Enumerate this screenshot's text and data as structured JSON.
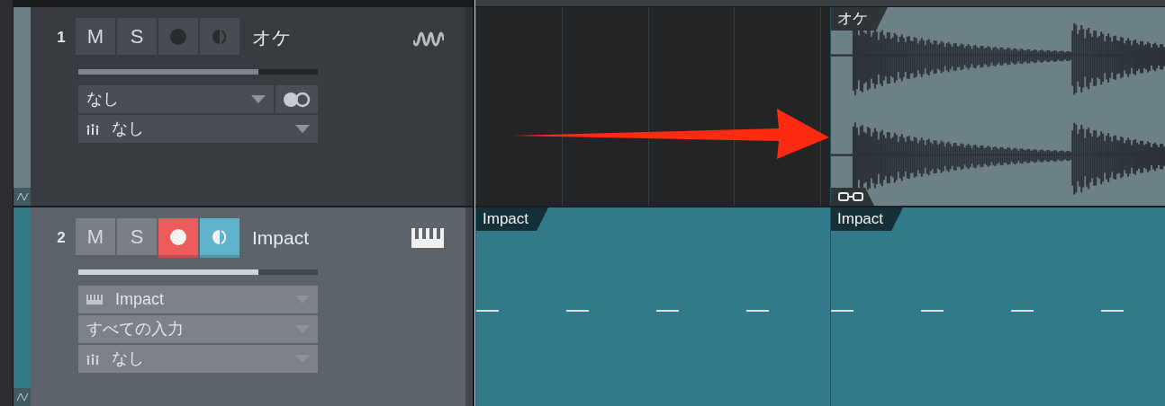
{
  "tracks": [
    {
      "number": "1",
      "mute_label": "M",
      "solo_label": "S",
      "name": "オケ",
      "kind": "audio",
      "color": "#6d8086",
      "selected": false,
      "muted": false,
      "solo": false,
      "record_armed": false,
      "monitor": false,
      "volume": {
        "level": 0.75
      },
      "rows": [
        {
          "kind": "input",
          "text": "なし",
          "stereo": true
        },
        {
          "kind": "output",
          "text": "なし"
        }
      ],
      "clips": [
        {
          "name": "オケ",
          "kind": "audio"
        }
      ]
    },
    {
      "number": "2",
      "mute_label": "M",
      "solo_label": "S",
      "name": "Impact",
      "kind": "instrument",
      "color": "#317a8a",
      "selected": true,
      "muted": false,
      "solo": false,
      "record_armed": true,
      "monitor": true,
      "volume": {
        "level": 0.75
      },
      "rows": [
        {
          "kind": "instrument",
          "text": "Impact"
        },
        {
          "kind": "input",
          "text": "すべての入力"
        },
        {
          "kind": "output",
          "text": "なし"
        }
      ],
      "clips": [
        {
          "name": "Impact",
          "kind": "note"
        },
        {
          "name": "Impact",
          "kind": "note"
        }
      ]
    }
  ]
}
